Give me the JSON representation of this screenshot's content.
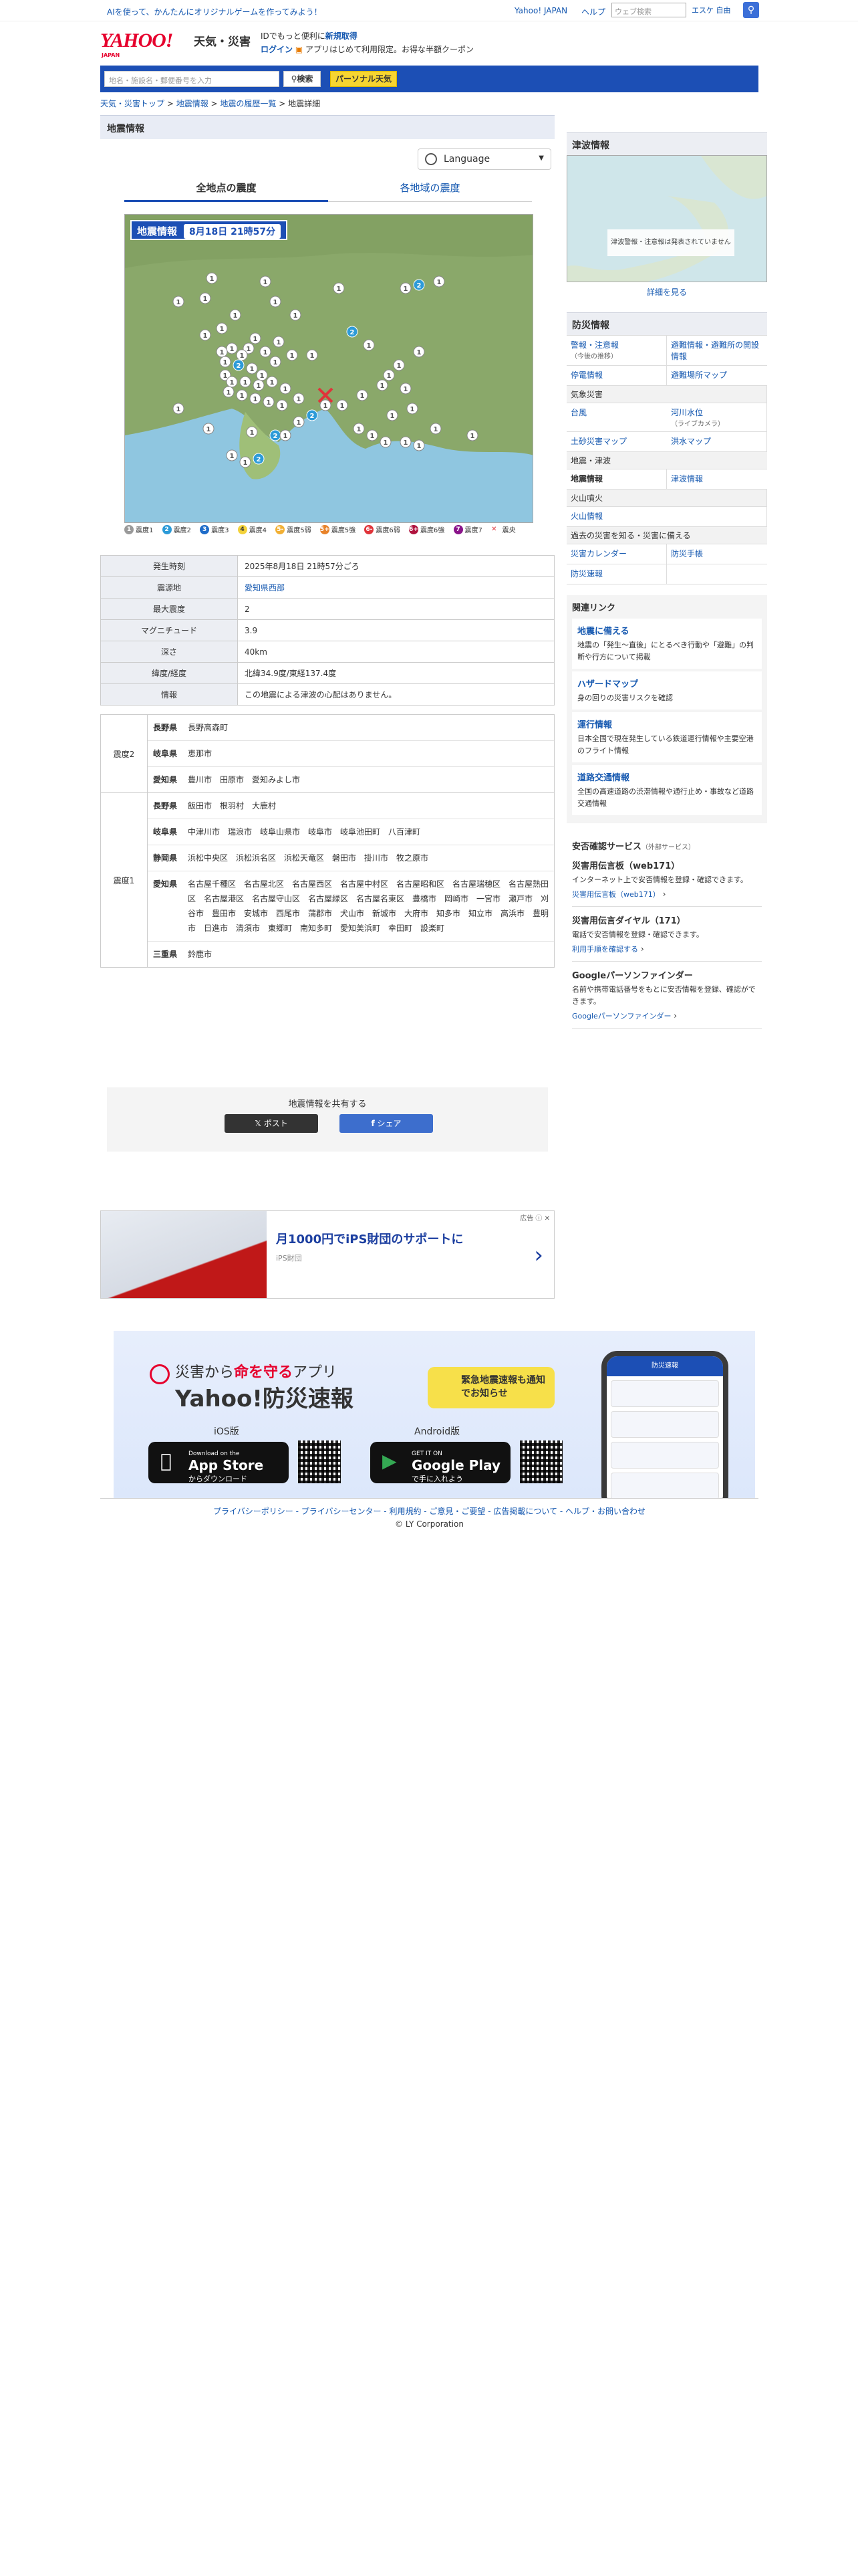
{
  "topbar": {
    "promo": "AIを使って、かんたんにオリジナルゲームを作ってみよう！",
    "links": [
      "Yahoo! JAPAN",
      "ヘルプ"
    ],
    "web_search_placeholder": "ウェブ検索",
    "escape_label": "エスケ 自由"
  },
  "header": {
    "logo_text": "YAHOO!",
    "logo_sub": "JAPAN",
    "brand": "天気・災害",
    "id_promo": "IDでもっと便利に",
    "signup": "新規取得",
    "login": "ログイン",
    "app_promo": "アプリはじめて利用限定。お得な半額クーポン"
  },
  "search": {
    "placeholder": "地名・施設名・郵便番号を入力",
    "button": "検索",
    "personal": "パーソナル天気"
  },
  "breadcrumb": [
    "天気・災害トップ",
    "地震情報",
    "地震の履歴一覧",
    "地震詳細"
  ],
  "main": {
    "title": "地震情報",
    "language": "Language",
    "tabs": [
      "全地点の震度",
      "各地域の震度"
    ],
    "map_title": "地震情報",
    "map_datetime": "8月18日 21時57分",
    "legend": [
      {
        "label": "震度1",
        "color": "#9a9a9a",
        "mark": "1"
      },
      {
        "label": "震度2",
        "color": "#2d9bd8",
        "mark": "2"
      },
      {
        "label": "震度3",
        "color": "#1f6cc9",
        "mark": "3"
      },
      {
        "label": "震度4",
        "color": "#f3d23a",
        "mark": "4"
      },
      {
        "label": "震度5弱",
        "color": "#f2b035",
        "mark": "5-"
      },
      {
        "label": "震度5強",
        "color": "#e8832a",
        "mark": "5+"
      },
      {
        "label": "震度6弱",
        "color": "#e0343a",
        "mark": "6-"
      },
      {
        "label": "震度6強",
        "color": "#b0143f",
        "mark": "6+"
      },
      {
        "label": "震度7",
        "color": "#8a148a",
        "mark": "7"
      },
      {
        "label": "震央",
        "color": "#e0343a",
        "mark": "×"
      }
    ],
    "info": [
      {
        "k": "発生時刻",
        "v": "2025年8月18日 21時57分ごろ"
      },
      {
        "k": "震源地",
        "v": "愛知県西部"
      },
      {
        "k": "最大震度",
        "v": "2"
      },
      {
        "k": "マグニチュード",
        "v": "3.9"
      },
      {
        "k": "深さ",
        "v": "40km"
      },
      {
        "k": "緯度/経度",
        "v": "北緯34.9度/東経137.4度"
      },
      {
        "k": "情報",
        "v": "この地震による津波の心配はありません。"
      }
    ],
    "severities": [
      {
        "label": "震度2",
        "rows": [
          {
            "pref": "長野県",
            "cities": "長野高森町"
          },
          {
            "pref": "岐阜県",
            "cities": "恵那市"
          },
          {
            "pref": "愛知県",
            "cities": "豊川市　田原市　愛知みよし市"
          }
        ]
      },
      {
        "label": "震度1",
        "rows": [
          {
            "pref": "長野県",
            "cities": "飯田市　根羽村　大鹿村"
          },
          {
            "pref": "岐阜県",
            "cities": "中津川市　瑞浪市　岐阜山県市　岐阜市　岐阜池田町　八百津町"
          },
          {
            "pref": "静岡県",
            "cities": "浜松中央区　浜松浜名区　浜松天竜区　磐田市　掛川市　牧之原市"
          },
          {
            "pref": "愛知県",
            "cities": "名古屋千種区　名古屋北区　名古屋西区　名古屋中村区　名古屋昭和区　名古屋瑞穂区　名古屋熱田区　名古屋港区　名古屋守山区　名古屋緑区　名古屋名東区　豊橋市　岡崎市　一宮市　瀬戸市　刈谷市　豊田市　安城市　西尾市　蒲郡市　犬山市　新城市　大府市　知多市　知立市　高浜市　豊明市　日進市　清須市　東郷町　南知多町　愛知美浜町　幸田町　設楽町"
          },
          {
            "pref": "三重県",
            "cities": "鈴鹿市"
          }
        ]
      }
    ],
    "share_title": "地震情報を共有する",
    "share_x": "ポスト",
    "share_fb": "シェア"
  },
  "sidebar": {
    "tsunami_title": "津波情報",
    "tsunami_msg": "津波警報・注意報は発表されていません",
    "tsunami_more": "詳細を見る",
    "bousai_title": "防災情報",
    "bousai": [
      {
        "t": "警報・注意報",
        "s": "（今後の推移）"
      },
      {
        "t": "避難情報・避難所の開設情報",
        "s": ""
      },
      {
        "t": "停電情報",
        "s": ""
      },
      {
        "t": "避難場所マップ",
        "s": ""
      },
      {
        "sub": "気象災害"
      },
      {
        "t": "台風",
        "s": ""
      },
      {
        "t": "河川水位",
        "s": "（ライブカメラ）"
      },
      {
        "t": "土砂災害マップ",
        "s": ""
      },
      {
        "t": "洪水マップ",
        "s": ""
      },
      {
        "sub": "地震・津波"
      },
      {
        "t": "地震情報",
        "s": "",
        "cur": true
      },
      {
        "t": "津波情報",
        "s": ""
      },
      {
        "sub": "火山噴火"
      },
      {
        "t": "火山情報",
        "s": ""
      },
      {
        "t": "",
        "s": ""
      },
      {
        "sub": "過去の災害を知る・災害に備える"
      },
      {
        "t": "災害カレンダー",
        "s": ""
      },
      {
        "t": "防災手帳",
        "s": ""
      },
      {
        "t": "防災速報",
        "s": ""
      },
      {
        "t": "",
        "s": ""
      }
    ],
    "related_title": "関連リンク",
    "related": [
      {
        "t": "地震に備える",
        "d": "地震の「発生～直後」にとるべき行動や「避難」の判断や行方について掲載"
      },
      {
        "t": "ハザードマップ",
        "d": "身の回りの災害リスクを確認"
      },
      {
        "t": "運行情報",
        "d": "日本全国で現在発生している鉄道運行情報や主要空港のフライト情報"
      },
      {
        "t": "道路交通情報",
        "d": "全国の高速道路の渋滞情報や通行止め・事故など道路交通情報"
      }
    ],
    "safety_title": "安否確認サービス",
    "safety_sub": "（外部サービス）",
    "safety": [
      {
        "t": "災害用伝言板（web171）",
        "d": "インターネット上で安否情報を登録・確認できます。",
        "l": "災害用伝言板（web171）"
      },
      {
        "t": "災害用伝言ダイヤル（171）",
        "d": "電話で安否情報を登録・確認できます。",
        "l": "利用手順を確認する"
      },
      {
        "t": "Googleパーソンファインダー",
        "d": "名前や携帯電話番号をもとに安否情報を登録、確認ができます。",
        "l": "Googleパーソンファインダー"
      }
    ]
  },
  "ad": {
    "label": "広告",
    "headline": "月1000円でiPS財団のサポートに",
    "sponsor": "iPS財団"
  },
  "app": {
    "line1_pre": "災害から",
    "line1_em": "命を守る",
    "line1_post": "アプリ",
    "name": "Yahoo!防災速報",
    "bubble": "緊急地震速報も通知でお知らせ",
    "ios": "iOS版",
    "android": "Android版",
    "appstore_top": "Download on the",
    "appstore": "App Store",
    "appstore_sub": "からダウンロード",
    "gplay_top": "GET IT ON",
    "gplay": "Google Play",
    "gplay_sub": "で手に入れよう",
    "phone_title": "防災速報"
  },
  "footer": {
    "links": "プライバシーポリシー - プライバシーセンター - 利用規約 - ご意見・ご要望 - 広告掲載について - ヘルプ・お問い合わせ",
    "copyright": "© LY Corporation"
  }
}
